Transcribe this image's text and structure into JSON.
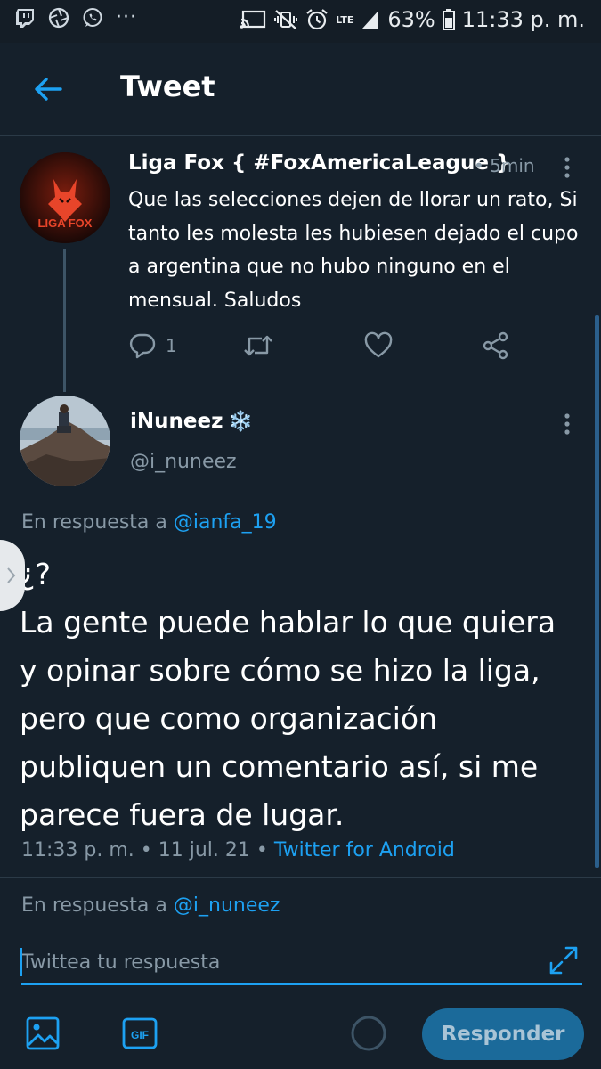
{
  "status_bar": {
    "battery": "63%",
    "time": "11:33 p. m.",
    "network": "LTE",
    "overflow": "···"
  },
  "header": {
    "title": "Tweet"
  },
  "parent_tweet": {
    "avatar_text": "LIGA FOX",
    "name": "Liga Fox { #FoxAmericaLeague }",
    "time": "• 5min",
    "text": "Que las selecciones dejen de llorar un rato, Si tanto les molesta les hubiesen dejado el cupo a argentina que no hubo ninguno en el mensual. Saludos",
    "reply_count": "1"
  },
  "main_tweet": {
    "name": "iNuneez",
    "name_emoji": "❄️",
    "handle": "@i_nuneez",
    "reply_prefix": "En respuesta a ",
    "reply_handle": "@ianfa_19",
    "text": "¿?\nLa gente puede hablar lo que quiera y opinar sobre cómo se hizo la liga, pero que como organización publiquen un comentario así, si me parece fuera de lugar.",
    "meta_time": "11:33 p. m. • 11 jul. 21 • ",
    "source": "Twitter for Android"
  },
  "composer": {
    "reply_prefix": "En respuesta a ",
    "reply_handle": "@i_nuneez",
    "placeholder": "Twittea tu respuesta",
    "gif_label": "GIF",
    "submit_label": "Responder"
  },
  "colors": {
    "background": "#15202b",
    "accent": "#1da1f2",
    "muted_text": "#8899a6"
  }
}
